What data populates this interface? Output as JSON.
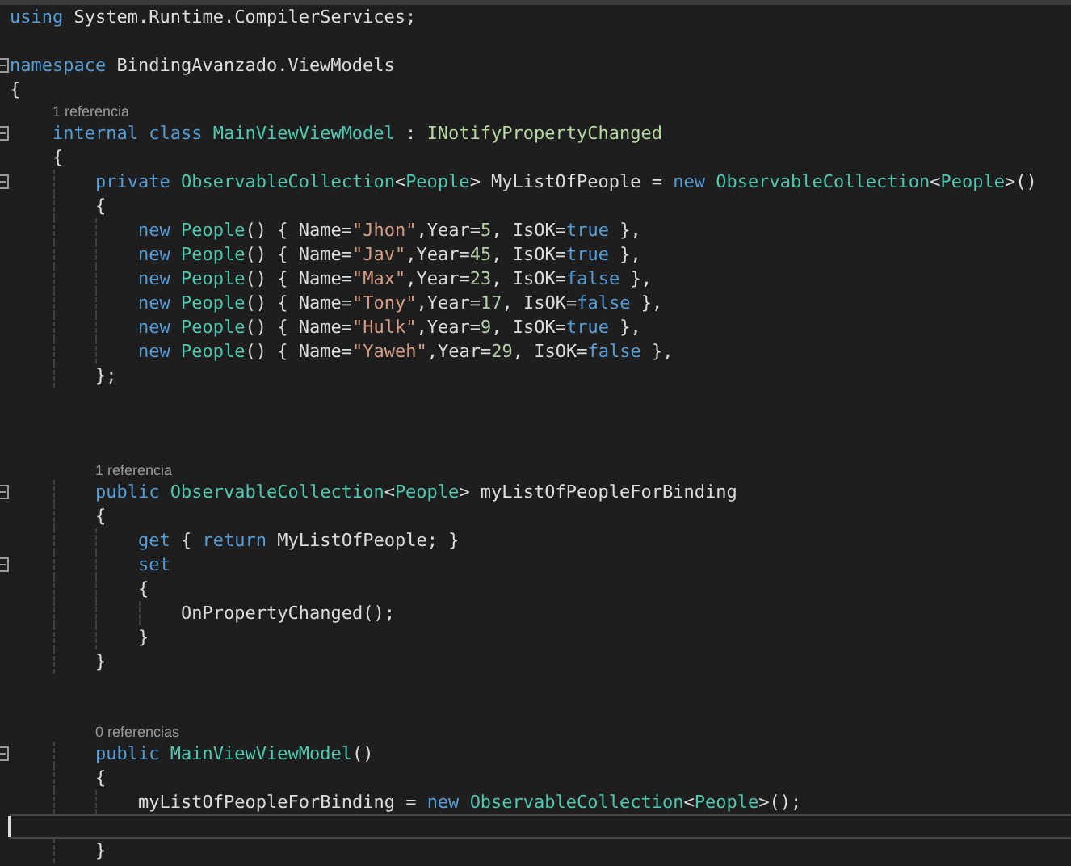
{
  "editor": {
    "lines": [
      {
        "kind": "code",
        "fold": false,
        "current": false,
        "tokens": [
          {
            "kind": "keyword",
            "text": "using"
          },
          {
            "kind": "plain",
            "text": " System.Runtime.CompilerServices;"
          }
        ]
      },
      {
        "kind": "blank",
        "fold": false,
        "current": false
      },
      {
        "kind": "code",
        "fold": true,
        "current": false,
        "tokens": [
          {
            "kind": "keyword",
            "text": "namespace"
          },
          {
            "kind": "plain",
            "text": " BindingAvanzado.ViewModels"
          }
        ]
      },
      {
        "kind": "code",
        "fold": false,
        "current": false,
        "tokens": [
          {
            "kind": "plain",
            "text": "{"
          }
        ]
      },
      {
        "kind": "code",
        "fold": true,
        "current": false,
        "lens": "1 referencia",
        "tokens": [
          {
            "kind": "keyword",
            "text": "    internal class "
          },
          {
            "kind": "type",
            "text": "MainViewViewModel"
          },
          {
            "kind": "plain",
            "text": " : "
          },
          {
            "kind": "interface",
            "text": "INotifyPropertyChanged"
          }
        ]
      },
      {
        "kind": "code",
        "fold": false,
        "current": false,
        "tokens": [
          {
            "kind": "plain",
            "text": "    {"
          }
        ]
      },
      {
        "kind": "code",
        "fold": true,
        "current": false,
        "tokens": [
          {
            "kind": "keyword",
            "text": "        private "
          },
          {
            "kind": "type",
            "text": "ObservableCollection"
          },
          {
            "kind": "plain",
            "text": "<"
          },
          {
            "kind": "type",
            "text": "People"
          },
          {
            "kind": "plain",
            "text": "> MyListOfPeople = "
          },
          {
            "kind": "keyword",
            "text": "new "
          },
          {
            "kind": "type",
            "text": "ObservableCollection"
          },
          {
            "kind": "plain",
            "text": "<"
          },
          {
            "kind": "type",
            "text": "People"
          },
          {
            "kind": "plain",
            "text": ">()"
          }
        ]
      },
      {
        "kind": "code",
        "fold": false,
        "current": false,
        "tokens": [
          {
            "kind": "plain",
            "text": "        {"
          }
        ]
      },
      {
        "kind": "code",
        "fold": false,
        "current": false,
        "tokens": [
          {
            "kind": "keyword",
            "text": "            new "
          },
          {
            "kind": "type",
            "text": "People"
          },
          {
            "kind": "plain",
            "text": "() { Name="
          },
          {
            "kind": "string",
            "text": "\"Jhon\""
          },
          {
            "kind": "plain",
            "text": ",Year="
          },
          {
            "kind": "number",
            "text": "5"
          },
          {
            "kind": "plain",
            "text": ", IsOK="
          },
          {
            "kind": "keyword",
            "text": "true"
          },
          {
            "kind": "plain",
            "text": " },"
          }
        ]
      },
      {
        "kind": "code",
        "fold": false,
        "current": false,
        "tokens": [
          {
            "kind": "keyword",
            "text": "            new "
          },
          {
            "kind": "type",
            "text": "People"
          },
          {
            "kind": "plain",
            "text": "() { Name="
          },
          {
            "kind": "string",
            "text": "\"Jav\""
          },
          {
            "kind": "plain",
            "text": ",Year="
          },
          {
            "kind": "number",
            "text": "45"
          },
          {
            "kind": "plain",
            "text": ", IsOK="
          },
          {
            "kind": "keyword",
            "text": "true"
          },
          {
            "kind": "plain",
            "text": " },"
          }
        ]
      },
      {
        "kind": "code",
        "fold": false,
        "current": false,
        "tokens": [
          {
            "kind": "keyword",
            "text": "            new "
          },
          {
            "kind": "type",
            "text": "People"
          },
          {
            "kind": "plain",
            "text": "() { Name="
          },
          {
            "kind": "string",
            "text": "\"Max\""
          },
          {
            "kind": "plain",
            "text": ",Year="
          },
          {
            "kind": "number",
            "text": "23"
          },
          {
            "kind": "plain",
            "text": ", IsOK="
          },
          {
            "kind": "keyword",
            "text": "false"
          },
          {
            "kind": "plain",
            "text": " },"
          }
        ]
      },
      {
        "kind": "code",
        "fold": false,
        "current": false,
        "tokens": [
          {
            "kind": "keyword",
            "text": "            new "
          },
          {
            "kind": "type",
            "text": "People"
          },
          {
            "kind": "plain",
            "text": "() { Name="
          },
          {
            "kind": "string",
            "text": "\"Tony\""
          },
          {
            "kind": "plain",
            "text": ",Year="
          },
          {
            "kind": "number",
            "text": "17"
          },
          {
            "kind": "plain",
            "text": ", IsOK="
          },
          {
            "kind": "keyword",
            "text": "false"
          },
          {
            "kind": "plain",
            "text": " },"
          }
        ]
      },
      {
        "kind": "code",
        "fold": false,
        "current": false,
        "tokens": [
          {
            "kind": "keyword",
            "text": "            new "
          },
          {
            "kind": "type",
            "text": "People"
          },
          {
            "kind": "plain",
            "text": "() { Name="
          },
          {
            "kind": "string",
            "text": "\"Hulk\""
          },
          {
            "kind": "plain",
            "text": ",Year="
          },
          {
            "kind": "number",
            "text": "9"
          },
          {
            "kind": "plain",
            "text": ", IsOK="
          },
          {
            "kind": "keyword",
            "text": "true"
          },
          {
            "kind": "plain",
            "text": " },"
          }
        ]
      },
      {
        "kind": "code",
        "fold": false,
        "current": false,
        "tokens": [
          {
            "kind": "keyword",
            "text": "            new "
          },
          {
            "kind": "type",
            "text": "People"
          },
          {
            "kind": "plain",
            "text": "() { Name="
          },
          {
            "kind": "string",
            "text": "\"Yaweh\""
          },
          {
            "kind": "plain",
            "text": ",Year="
          },
          {
            "kind": "number",
            "text": "29"
          },
          {
            "kind": "plain",
            "text": ", IsOK="
          },
          {
            "kind": "keyword",
            "text": "false"
          },
          {
            "kind": "plain",
            "text": " },"
          }
        ]
      },
      {
        "kind": "code",
        "fold": false,
        "current": false,
        "tokens": [
          {
            "kind": "plain",
            "text": "        };"
          }
        ]
      },
      {
        "kind": "blank",
        "fold": false,
        "current": false
      },
      {
        "kind": "blank",
        "fold": false,
        "current": false
      },
      {
        "kind": "blank",
        "fold": false,
        "current": false
      },
      {
        "kind": "code",
        "fold": true,
        "current": false,
        "lens": "1 referencia",
        "tokens": [
          {
            "kind": "keyword",
            "text": "        public "
          },
          {
            "kind": "type",
            "text": "ObservableCollection"
          },
          {
            "kind": "plain",
            "text": "<"
          },
          {
            "kind": "type",
            "text": "People"
          },
          {
            "kind": "plain",
            "text": "> myListOfPeopleForBinding"
          }
        ]
      },
      {
        "kind": "code",
        "fold": false,
        "current": false,
        "tokens": [
          {
            "kind": "plain",
            "text": "        {"
          }
        ]
      },
      {
        "kind": "code",
        "fold": false,
        "current": false,
        "tokens": [
          {
            "kind": "keyword",
            "text": "            get"
          },
          {
            "kind": "plain",
            "text": " { "
          },
          {
            "kind": "keyword",
            "text": "return"
          },
          {
            "kind": "plain",
            "text": " MyListOfPeople; }"
          }
        ]
      },
      {
        "kind": "code",
        "fold": true,
        "current": false,
        "tokens": [
          {
            "kind": "keyword",
            "text": "            set"
          }
        ]
      },
      {
        "kind": "code",
        "fold": false,
        "current": false,
        "tokens": [
          {
            "kind": "plain",
            "text": "            {"
          }
        ]
      },
      {
        "kind": "code",
        "fold": false,
        "current": false,
        "tokens": [
          {
            "kind": "plain",
            "text": "                OnPropertyChanged();"
          }
        ]
      },
      {
        "kind": "code",
        "fold": false,
        "current": false,
        "tokens": [
          {
            "kind": "plain",
            "text": "            }"
          }
        ]
      },
      {
        "kind": "code",
        "fold": false,
        "current": false,
        "tokens": [
          {
            "kind": "plain",
            "text": "        }"
          }
        ]
      },
      {
        "kind": "blank",
        "fold": false,
        "current": false
      },
      {
        "kind": "blank",
        "fold": false,
        "current": false
      },
      {
        "kind": "code",
        "fold": true,
        "current": false,
        "lens": "0 referencias",
        "tokens": [
          {
            "kind": "keyword",
            "text": "        public "
          },
          {
            "kind": "type",
            "text": "MainViewViewModel"
          },
          {
            "kind": "plain",
            "text": "()"
          }
        ]
      },
      {
        "kind": "code",
        "fold": false,
        "current": false,
        "tokens": [
          {
            "kind": "plain",
            "text": "        {"
          }
        ]
      },
      {
        "kind": "code",
        "fold": false,
        "current": false,
        "tokens": [
          {
            "kind": "plain",
            "text": "            myListOfPeopleForBinding = "
          },
          {
            "kind": "keyword",
            "text": "new "
          },
          {
            "kind": "type",
            "text": "ObservableCollection"
          },
          {
            "kind": "plain",
            "text": "<"
          },
          {
            "kind": "type",
            "text": "People"
          },
          {
            "kind": "plain",
            "text": ">();"
          }
        ]
      },
      {
        "kind": "blank",
        "fold": false,
        "current": true
      },
      {
        "kind": "code",
        "fold": false,
        "current": false,
        "tokens": [
          {
            "kind": "plain",
            "text": "        }"
          }
        ]
      }
    ]
  }
}
